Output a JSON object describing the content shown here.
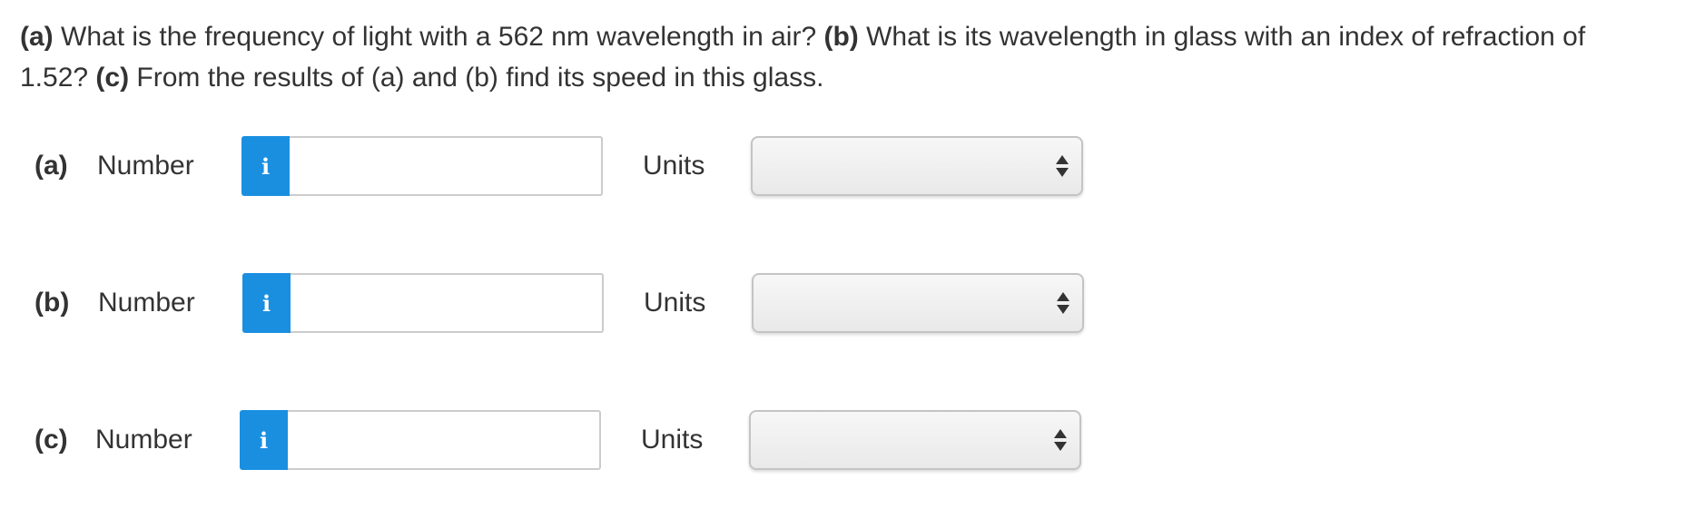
{
  "question": {
    "a_tag": "(a)",
    "a_text": " What is the frequency of light with a 562 nm wavelength in air? ",
    "b_tag": "(b)",
    "b_text": " What is its wavelength in glass with an index of refraction of 1.52? ",
    "c_tag": "(c)",
    "c_text": " From the results of (a) and (b) find its speed in this glass."
  },
  "parts": [
    {
      "label": "(a)",
      "number_label": "Number",
      "info_icon": "i",
      "number_value": "",
      "units_label": "Units",
      "units_value": ""
    },
    {
      "label": "(b)",
      "number_label": "Number",
      "info_icon": "i",
      "number_value": "",
      "units_label": "Units",
      "units_value": ""
    },
    {
      "label": "(c)",
      "number_label": "Number",
      "info_icon": "i",
      "number_value": "",
      "units_label": "Units",
      "units_value": ""
    }
  ],
  "colors": {
    "info_button": "#1a8fe0",
    "text": "#333333"
  }
}
